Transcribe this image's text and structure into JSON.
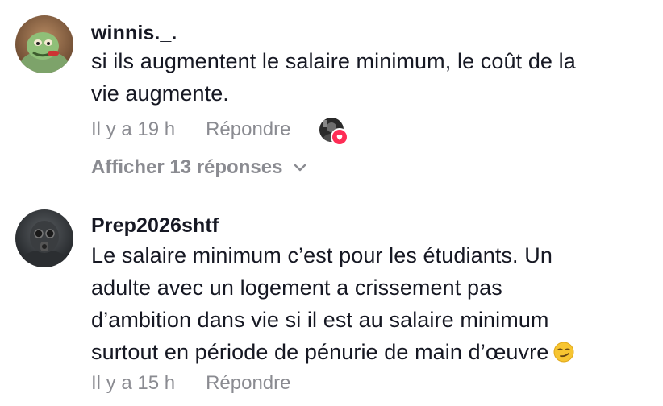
{
  "comments": [
    {
      "username": "winnis._.",
      "text_lines": [
        "si ils augmentent le salaire minimum, le coût de la",
        "vie augmente."
      ],
      "time": "Il y a 19 h",
      "reply_label": "Répondre",
      "view_replies": "Afficher 13 réponses",
      "liked_by_creator": true
    },
    {
      "username": "Prep2026shtf",
      "text_lines": [
        "Le salaire minimum c’est pour les étudiants. Un",
        "adulte avec un logement a crissement pas",
        "d’ambition dans vie si il est au salaire minimum",
        "surtout en période de pénurie de main d’œuvre"
      ],
      "emoji": "smirking-face",
      "time": "Il y a 15 h",
      "reply_label": "Répondre"
    }
  ],
  "colors": {
    "text": "#161823",
    "meta": "#8a8b91",
    "heart": "#fe2c55"
  },
  "icons": [
    "chevron-down-icon",
    "heart-icon",
    "smirk-emoji"
  ]
}
